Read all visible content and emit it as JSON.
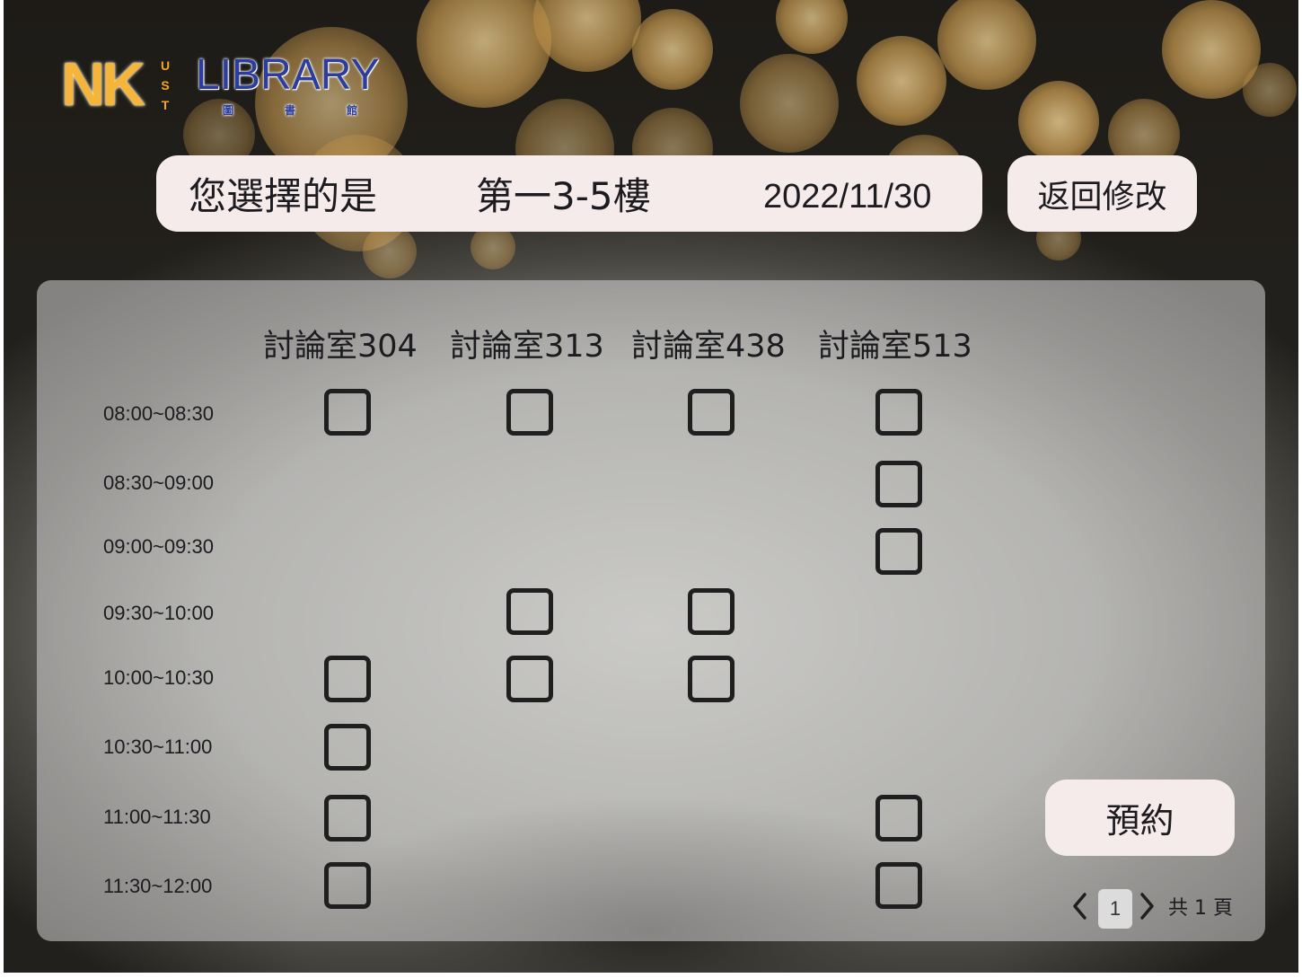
{
  "logo": {
    "nk": "NK",
    "ust": [
      "U",
      "S",
      "T"
    ],
    "library": "LIBRARY",
    "subtitle": [
      "圖",
      "書",
      "館"
    ]
  },
  "selection": {
    "label": "您選擇的是",
    "floor": "第一3-5樓",
    "date": "2022/11/30",
    "back_label": "返回修改"
  },
  "rooms": [
    "討論室304",
    "討論室313",
    "討論室438",
    "討論室513"
  ],
  "time_slots": [
    "08:00~08:30",
    "08:30~09:00",
    "09:00~09:30",
    "09:30~10:00",
    "10:00~10:30",
    "10:30~11:00",
    "11:00~11:30",
    "11:30~12:00"
  ],
  "availability": [
    [
      true,
      true,
      true,
      true
    ],
    [
      false,
      false,
      false,
      true
    ],
    [
      false,
      false,
      false,
      true
    ],
    [
      false,
      true,
      true,
      false
    ],
    [
      true,
      true,
      true,
      false
    ],
    [
      true,
      false,
      false,
      false
    ],
    [
      true,
      false,
      false,
      true
    ],
    [
      true,
      false,
      false,
      true
    ]
  ],
  "reserve_label": "預約",
  "pagination": {
    "current_page": "1",
    "total_text": "共 1 頁"
  },
  "icons": {
    "prev": "chevron-left-icon",
    "next": "chevron-right-icon"
  }
}
